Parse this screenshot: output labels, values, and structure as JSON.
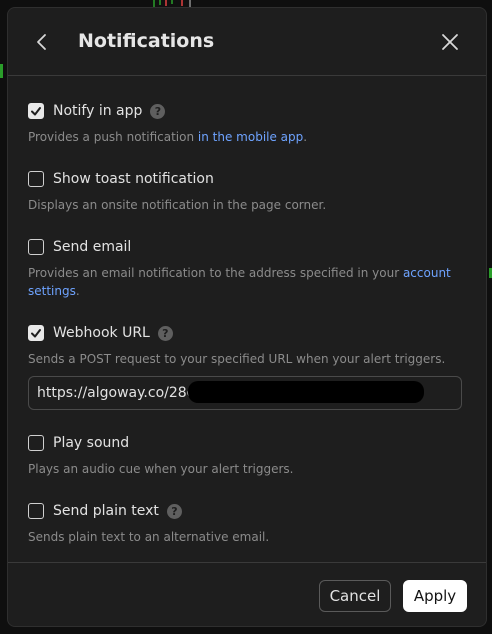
{
  "dialog": {
    "title": "Notifications"
  },
  "options": [
    {
      "label": "Notify in app",
      "checked": true,
      "has_help": true,
      "desc_before": "Provides a push notification ",
      "desc_link": "in the mobile app",
      "desc_after": "."
    },
    {
      "label": "Show toast notification",
      "checked": false,
      "has_help": false,
      "description": "Displays an onsite notification in the page corner."
    },
    {
      "label": "Send email",
      "checked": false,
      "has_help": false,
      "desc_before": "Provides an email notification to the address specified in your ",
      "desc_link": "account settings",
      "desc_after": "."
    },
    {
      "label": "Webhook URL",
      "checked": true,
      "has_help": true,
      "description": "Sends a POST request to your specified URL when your alert triggers."
    },
    {
      "label": "Play sound",
      "checked": false,
      "has_help": false,
      "description": "Plays an audio cue when your alert triggers."
    },
    {
      "label": "Send plain text",
      "checked": false,
      "has_help": true,
      "description": "Sends plain text to an alternative email."
    }
  ],
  "webhook": {
    "value": "https://algoway.co/28eb"
  },
  "help_glyph": "?",
  "footer": {
    "cancel_label": "Cancel",
    "apply_label": "Apply"
  },
  "colors": {
    "dialog_bg": "#1e1e1e",
    "link": "#6ea3ff",
    "text": "#e2e2e2",
    "muted": "#8b8b8b"
  },
  "icons": {
    "back": "chevron-left-icon",
    "close": "close-icon",
    "check": "checkmark-icon",
    "help": "question-mark-icon"
  }
}
